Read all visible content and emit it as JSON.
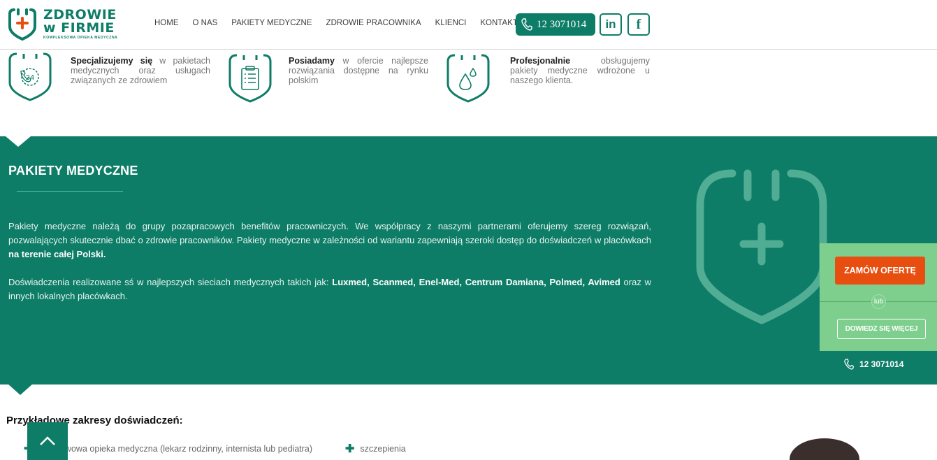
{
  "header": {
    "logo": {
      "line1": "ZDROWIE",
      "line2": "w FIRMIE",
      "tagline": "KOMPLEKSOWA OPIEKA MEDYCZNA"
    },
    "nav": [
      "HOME",
      "O NAS",
      "PAKIETY MEDYCZNE",
      "ZDROWIE PRACOWNIKA",
      "KLIENCI",
      "KONTAKT"
    ],
    "phone": "12 3071014",
    "social": {
      "linkedin": "in",
      "facebook": "f"
    }
  },
  "features": [
    {
      "bold": "Specjalizujemy się",
      "rest": " w pakietach medycznych oraz usługach związanych ze zdrowiem",
      "badge": "24"
    },
    {
      "bold": "Posiadamy",
      "rest": " w ofercie najlepsze rozwiązania dostępne na rynku polskim"
    },
    {
      "bold": "Profesjonalnie",
      "rest": " obsługujemy pakiety medyczne wdrożone u naszego klienta."
    }
  ],
  "section": {
    "title": "PAKIETY MEDYCZNE",
    "p1_text": "Pakiety medyczne należą do grupy pozapracowych benefitów pracowniczych. We współpracy z naszymi partnerami oferujemy szereg rozwiązań, pozwalających skutecznie dbać o zdrowie pracowników. Pakiety medyczne w zależności od wariantu zapewniają szeroki dostęp do doświadczeń w placówkach ",
    "p1_bold": "na terenie całej Polski.",
    "p2_text": "Doświadczenia realizowane sś w najlepszych sieciach medycznych takich jak: ",
    "p2_bold": "Luxmed, Scanmed, Enel-Med, Centrum Damiana, Polmed, Avimed",
    "p2_end": " oraz w innych lokalnych placówkach."
  },
  "cta": {
    "order": "ZAMÓW OFERTĘ",
    "or": "lub",
    "more": "DOWIEDZ SIĘ WIĘCEJ",
    "phone": "12 3071014"
  },
  "examples": {
    "title": "Przykładowe zakresy doświadczeń:",
    "items": [
      "podstawowa opieka medyczna (lekarz rodzinny, internista lub pediatra)",
      "szczepienia"
    ]
  },
  "colors": {
    "brand": "#0e7d67",
    "accent": "#e84e10",
    "cta_bg": "#7ecf8e"
  }
}
